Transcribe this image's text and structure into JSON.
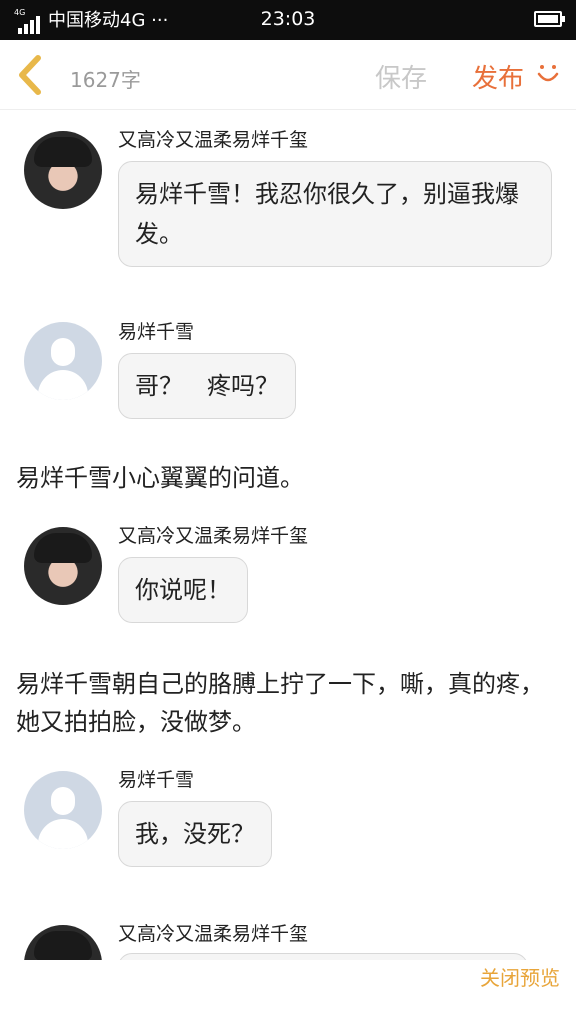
{
  "status_bar": {
    "network_tiny": "4G",
    "carrier": "中国移动4G ···",
    "time": "23:03"
  },
  "toolbar": {
    "word_count": "1627字",
    "save_label": "保存",
    "publish_label": "发布",
    "colors": {
      "publish": "#e8703a",
      "back": "#e8b84a",
      "save_disabled": "#c8c8c8"
    }
  },
  "messages": [
    {
      "type": "chat",
      "speaker": "又高冷又温柔易烊千玺",
      "avatar": "photo",
      "text": "易烊千雪！我忍你很久了，别逼我爆发。"
    },
    {
      "type": "chat",
      "speaker": "易烊千雪",
      "avatar": "default",
      "text": "哥？　疼吗？"
    },
    {
      "type": "narration",
      "text": "易烊千雪小心翼翼的问道。"
    },
    {
      "type": "chat",
      "speaker": "又高冷又温柔易烊千玺",
      "avatar": "photo",
      "text": "你说呢！"
    },
    {
      "type": "narration",
      "text": "易烊千雪朝自己的胳膊上拧了一下，嘶，真的疼，她又拍拍脸，没做梦。"
    },
    {
      "type": "chat",
      "speaker": "易烊千雪",
      "avatar": "default",
      "text": "我，没死？"
    },
    {
      "type": "chat",
      "speaker": "又高冷又温柔易烊千玺",
      "avatar": "photo",
      "text": ""
    }
  ],
  "footer": {
    "close_preview_label": "关闭预览"
  }
}
